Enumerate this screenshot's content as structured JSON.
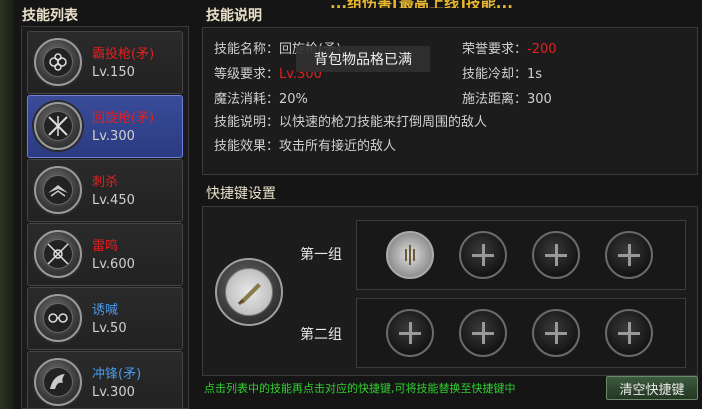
{
  "banner": {
    "text": "...组伤害[最高上线]技能...",
    "color": "#e8b830"
  },
  "skill_list": {
    "title": "技能列表",
    "items": [
      {
        "name": "霸投枪(矛)",
        "level": "Lv.150",
        "color": "red",
        "icon": "crossed-spears-icon"
      },
      {
        "name": "回旋枪(矛)",
        "level": "Lv.300",
        "color": "red",
        "icon": "spinning-spear-icon",
        "selected": true
      },
      {
        "name": "刺杀",
        "level": "Lv.450",
        "color": "red",
        "icon": "thrust-icon"
      },
      {
        "name": "雷鸣",
        "level": "Lv.600",
        "color": "red",
        "icon": "thunder-icon"
      },
      {
        "name": "诱喊",
        "level": "Lv.50",
        "color": "blue",
        "icon": "taunt-icon"
      },
      {
        "name": "冲锋(矛)",
        "level": "Lv.300",
        "color": "blue",
        "icon": "charge-icon"
      }
    ]
  },
  "skill_info": {
    "title": "技能说明",
    "name_label": "技能名称：",
    "name_value": "回旋枪(矛)",
    "honor_label": "荣誉要求：",
    "honor_value": "-200",
    "level_label": "等级要求：",
    "level_value": "Lv.300",
    "cooldown_label": "技能冷却：",
    "cooldown_value": "1s",
    "mana_label": "魔法消耗：",
    "mana_value": "20%",
    "range_label": "施法距离：",
    "range_value": "300",
    "desc_label": "技能说明：",
    "desc_value": "以快速的枪刀技能来打倒周围的敌人",
    "effect_label": "技能效果：",
    "effect_value": "攻击所有接近的敌人"
  },
  "toast": {
    "text": "背包物品格已满"
  },
  "shortcut": {
    "title": "快捷键设置",
    "group1_label": "第一组",
    "group2_label": "第二组",
    "hint": "点击列表中的技能再点击对应的快捷键,可将技能替换至快捷键中",
    "clear_button": "清空快捷键"
  },
  "colors": {
    "accent_red": "#e02020",
    "accent_blue": "#4a9ae8",
    "hint_green": "#30d030",
    "selected_bg": "#2a3b80"
  }
}
